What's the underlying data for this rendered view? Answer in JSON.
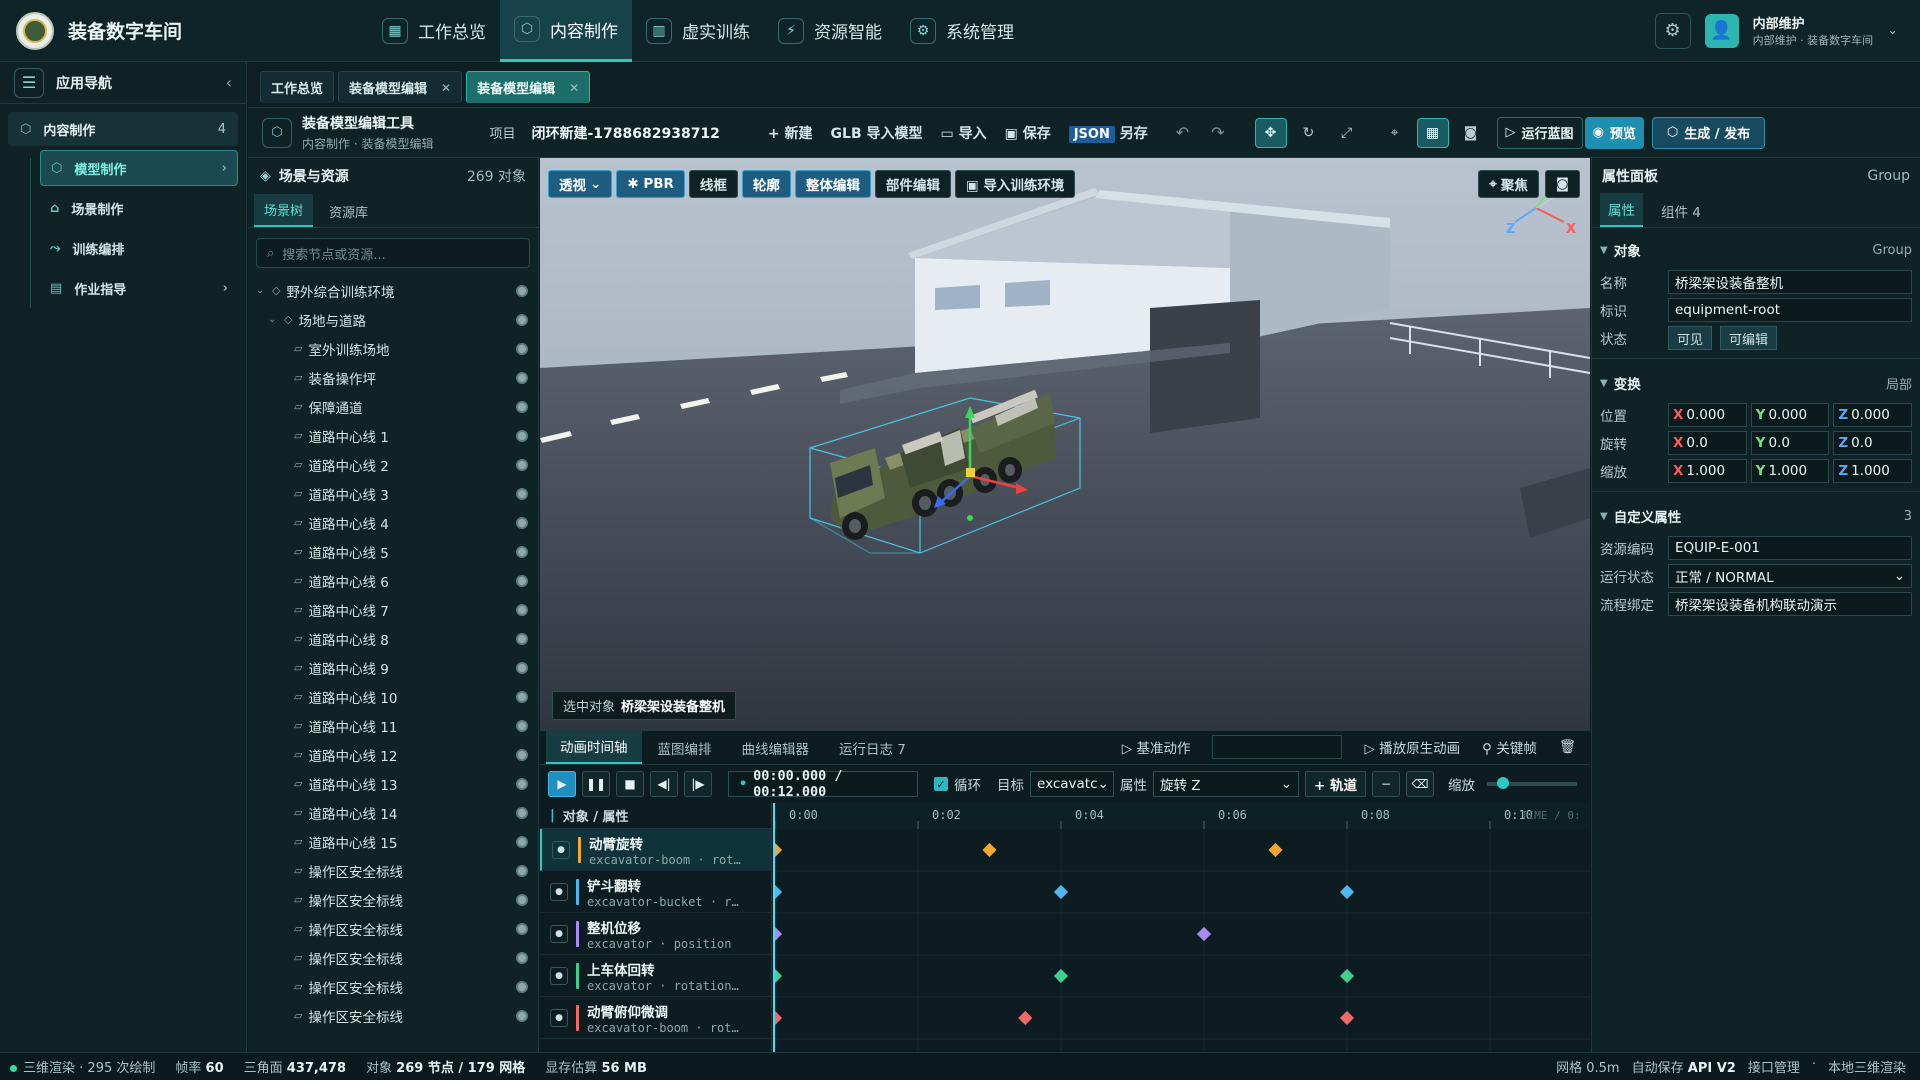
{
  "app": {
    "title": "装备数字车间"
  },
  "topnav": [
    {
      "label": "工作总览",
      "icon": "grid-icon"
    },
    {
      "label": "内容制作",
      "icon": "cube-icon",
      "active": true
    },
    {
      "label": "虚实训练",
      "icon": "book-icon"
    },
    {
      "label": "资源智能",
      "icon": "ai-icon"
    },
    {
      "label": "系统管理",
      "icon": "gear-icon"
    }
  ],
  "user": {
    "name": "内部维护",
    "sub": "内部维护 · 装备数字车间"
  },
  "leftnav": {
    "title": "应用导航",
    "group": {
      "label": "内容制作",
      "count": "4"
    },
    "items": [
      {
        "label": "模型制作",
        "active": true
      },
      {
        "label": "场景制作"
      },
      {
        "label": "训练编排"
      },
      {
        "label": "作业指导"
      }
    ]
  },
  "doc_tabs": [
    {
      "label": "工作总览"
    },
    {
      "label": "装备模型编辑"
    },
    {
      "label": "装备模型编辑",
      "active": true
    }
  ],
  "toolbar": {
    "title": "装备模型编辑工具",
    "breadcrumb": "内容制作 · 装备模型编辑",
    "project_label": "项目",
    "project_name": "闭环新建-1788682938712",
    "new_label": "+ 新建",
    "glb_label": "GLB 导入模型",
    "import_label": "导入",
    "save_label": "保存",
    "json_label": "JSON",
    "saveas_label": "另存",
    "run_label": "运行蓝图",
    "preview_label": "预览",
    "publish_label": "生成 / 发布"
  },
  "scene": {
    "title": "场景与资源",
    "count": "269 对象",
    "tabs": [
      "场景树",
      "资源库"
    ],
    "search_placeholder": "搜索节点或资源...",
    "tree": [
      {
        "label": "野外综合训练环境",
        "level": 0,
        "type": "group"
      },
      {
        "label": "场地与道路",
        "level": 1,
        "type": "group"
      },
      {
        "label": "室外训练场地",
        "level": 2
      },
      {
        "label": "装备操作坪",
        "level": 2
      },
      {
        "label": "保障通道",
        "level": 2
      },
      {
        "label": "道路中心线 1",
        "level": 2
      },
      {
        "label": "道路中心线 2",
        "level": 2
      },
      {
        "label": "道路中心线 3",
        "level": 2
      },
      {
        "label": "道路中心线 4",
        "level": 2
      },
      {
        "label": "道路中心线 5",
        "level": 2
      },
      {
        "label": "道路中心线 6",
        "level": 2
      },
      {
        "label": "道路中心线 7",
        "level": 2
      },
      {
        "label": "道路中心线 8",
        "level": 2
      },
      {
        "label": "道路中心线 9",
        "level": 2
      },
      {
        "label": "道路中心线 10",
        "level": 2
      },
      {
        "label": "道路中心线 11",
        "level": 2
      },
      {
        "label": "道路中心线 12",
        "level": 2
      },
      {
        "label": "道路中心线 13",
        "level": 2
      },
      {
        "label": "道路中心线 14",
        "level": 2
      },
      {
        "label": "道路中心线 15",
        "level": 2
      },
      {
        "label": "操作区安全标线",
        "level": 2
      },
      {
        "label": "操作区安全标线",
        "level": 2
      },
      {
        "label": "操作区安全标线",
        "level": 2
      },
      {
        "label": "操作区安全标线",
        "level": 2
      },
      {
        "label": "操作区安全标线",
        "level": 2
      },
      {
        "label": "操作区安全标线",
        "level": 2
      }
    ]
  },
  "viewport": {
    "buttons": [
      {
        "label": "透视",
        "on": true
      },
      {
        "label": "✱ PBR",
        "on": true
      },
      {
        "label": "线框"
      },
      {
        "label": "轮廓",
        "on": true
      },
      {
        "label": "整体编辑",
        "on": true
      },
      {
        "label": "部件编辑"
      },
      {
        "label": "▣ 导入训练环境"
      }
    ],
    "focus_label": "聚焦",
    "selected_prefix": "选中对象",
    "selected_name": "桥梁架设装备整机",
    "gizmo": {
      "x": "X",
      "y": "Y",
      "z": "Z"
    }
  },
  "props": {
    "title": "属性面板",
    "type": "Group",
    "tabs": [
      "属性",
      "组件 4"
    ],
    "object": {
      "title": "对象",
      "right": "Group",
      "name_label": "名称",
      "name": "桥梁架设装备整机",
      "id_label": "标识",
      "id": "equipment-root",
      "state_label": "状态",
      "state_visible": "可见",
      "state_editable": "可编辑"
    },
    "transform": {
      "title": "变换",
      "right": "局部",
      "position_label": "位置",
      "position": [
        "0.000",
        "0.000",
        "0.000"
      ],
      "rotation_label": "旋转",
      "rotation": [
        "0.0",
        "0.0",
        "0.0"
      ],
      "scale_label": "缩放",
      "scale": [
        "1.000",
        "1.000",
        "1.000"
      ]
    },
    "custom": {
      "title": "自定义属性",
      "count": "3",
      "code_label": "资源编码",
      "code": "EQUIP-E-001",
      "status_label": "运行状态",
      "status": "正常 / NORMAL",
      "flow_label": "流程绑定",
      "flow": "桥梁架设装备机构联动演示"
    }
  },
  "timeline": {
    "tabs": [
      "动画时间轴",
      "蓝图编排",
      "曲线编辑器",
      "运行日志 7"
    ],
    "base_action": "基准动作",
    "play_native": "播放原生动画",
    "keyframe": "关键帧",
    "time": "00:00.000 / 00:12.000",
    "loop_label": "循环",
    "target_label": "目标",
    "target_value": "excavatc",
    "prop_label": "属性",
    "prop_value": "旋转 Z",
    "add_track": "+ 轨道",
    "zoom_label": "缩放",
    "header": "对象 / 属性",
    "ruler": [
      "0:00",
      "0:02",
      "0:04",
      "0:06",
      "0:08",
      "0:10"
    ],
    "ruler_end": "TIME / 0:",
    "tracks": [
      {
        "name": "动臂旋转",
        "sub": "excavator-boom · rot…",
        "color": "#f0a830",
        "keys": [
          0,
          3,
          7
        ]
      },
      {
        "name": "铲斗翻转",
        "sub": "excavator-bucket · r…",
        "color": "#4fb8f0",
        "keys": [
          0,
          4,
          8
        ]
      },
      {
        "name": "整机位移",
        "sub": "excavator · position",
        "color": "#a98cf0",
        "keys": [
          0,
          6
        ]
      },
      {
        "name": "上车体回转",
        "sub": "excavator · rotation…",
        "color": "#3fd08f",
        "keys": [
          0,
          4,
          8
        ]
      },
      {
        "name": "动臂俯仰微调",
        "sub": "excavator-boom · rot…",
        "color": "#f06a6a",
        "keys": [
          0,
          3.5,
          8
        ]
      }
    ]
  },
  "status": {
    "render": "三维渲染",
    "draws": "295 次绘制",
    "fps_label": "帧率",
    "fps": "60",
    "tri_label": "三角面",
    "tri": "437,478",
    "obj_label": "对象",
    "obj": "269 节点 / 179 网格",
    "mem_label": "显存估算",
    "mem": "56 MB",
    "grid": "网格 0.5m",
    "autosave": "自动保存",
    "api": "API V2",
    "iface": "接口管理",
    "local": "本地三维渲染"
  }
}
